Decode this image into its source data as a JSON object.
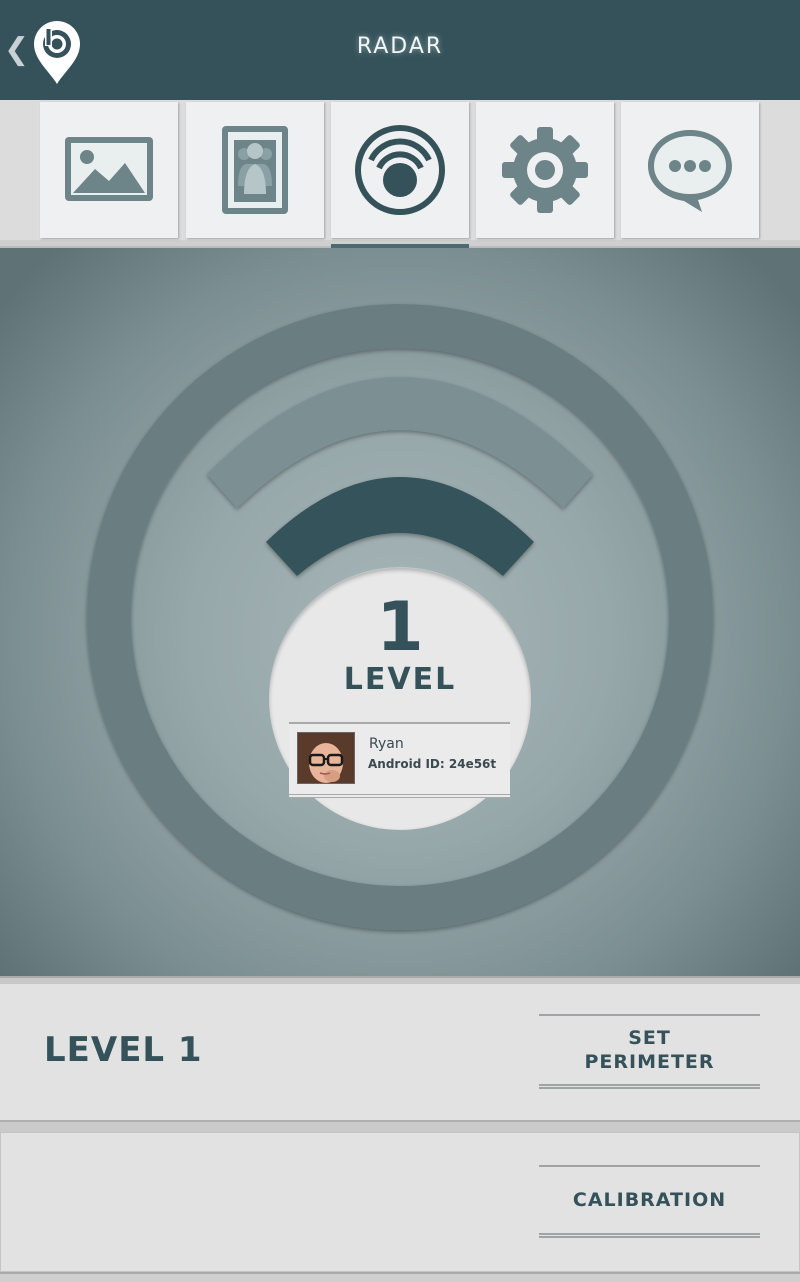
{
  "header": {
    "back_glyph": "❮",
    "logo_icon": "location-pin-logo-icon",
    "title": "RADAR"
  },
  "tabs": [
    {
      "icon": "image-icon",
      "selected": false
    },
    {
      "icon": "group-contacts-icon",
      "selected": false
    },
    {
      "icon": "radar-icon",
      "selected": true
    },
    {
      "icon": "gear-icon",
      "selected": false
    },
    {
      "icon": "chat-bubble-icon",
      "selected": false
    }
  ],
  "radar": {
    "level_number": "1",
    "level_word": "LEVEL",
    "active_level": 1,
    "user": {
      "name": "Ryan",
      "device_id": "Android ID: 24e56t",
      "avatar_icon": "child-with-glasses-photo"
    }
  },
  "panel": {
    "level_label": "LEVEL 1",
    "set_perimeter_line1": "SET",
    "set_perimeter_line2": "PERIMETER",
    "calibration_label": "CALIBRATION"
  },
  "colors": {
    "header_bg": "#35525a",
    "accent": "#4c6a74",
    "active_arc": "#35525a",
    "ring": "#6a7e82",
    "panel_bg": "#e2e2e2"
  }
}
